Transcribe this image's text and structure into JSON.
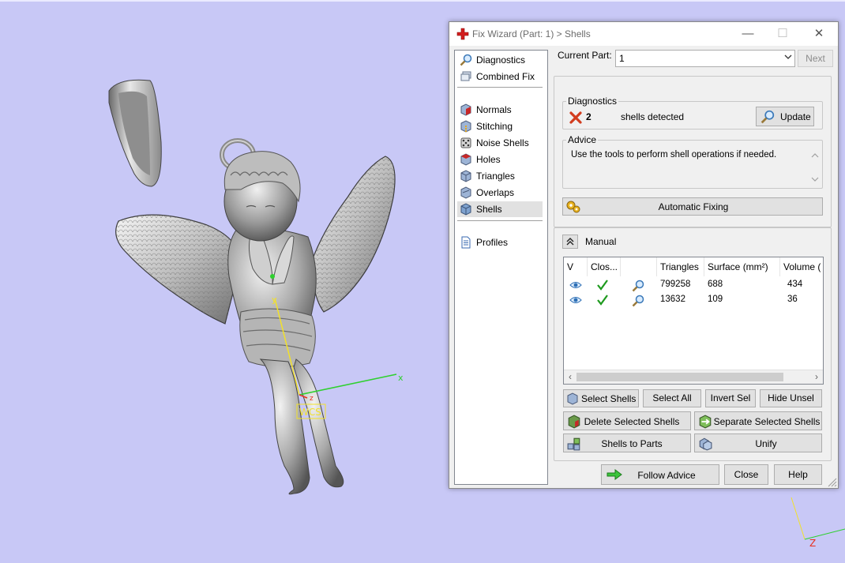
{
  "dialog": {
    "title": "Fix Wizard (Part: 1) > Shells",
    "window_controls": {
      "minimize": "—",
      "maximize": "☐",
      "close": "✕"
    }
  },
  "nav": {
    "top_items": [
      {
        "label": "Diagnostics",
        "icon": "magnifier-icon"
      },
      {
        "label": "Combined Fix",
        "icon": "stack-icon"
      }
    ],
    "fix_items": [
      {
        "label": "Normals",
        "icon": "normals-cube-icon"
      },
      {
        "label": "Stitching",
        "icon": "stitching-cube-icon"
      },
      {
        "label": "Noise Shells",
        "icon": "noise-dice-icon"
      },
      {
        "label": "Holes",
        "icon": "holes-cube-icon"
      },
      {
        "label": "Triangles",
        "icon": "triangles-cube-icon"
      },
      {
        "label": "Overlaps",
        "icon": "overlaps-cube-icon"
      },
      {
        "label": "Shells",
        "icon": "shells-cube-icon",
        "selected": true
      }
    ],
    "bottom_items": [
      {
        "label": "Profiles",
        "icon": "document-icon"
      }
    ]
  },
  "current_part": {
    "label": "Current Part:",
    "value": "1",
    "next_label": "Next"
  },
  "diagnostics": {
    "title": "Diagnostics",
    "count": "2",
    "text": "shells detected",
    "update_label": "Update",
    "status_color": "#d23c1e"
  },
  "advice": {
    "title": "Advice",
    "text": "Use the tools to perform shell operations if needed."
  },
  "auto_fix_label": "Automatic Fixing",
  "manual": {
    "title": "Manual",
    "columns": [
      "V",
      "Clos...",
      "",
      "Triangles",
      "Surface (mm²)",
      "Volume ("
    ],
    "rows": [
      {
        "triangles": "799258",
        "surface": "688",
        "volume": "434"
      },
      {
        "triangles": "13632",
        "surface": "109",
        "volume": "36"
      }
    ],
    "buttons": {
      "select_shells": "Select Shells",
      "select_all": "Select All",
      "invert_sel": "Invert Sel",
      "hide_unsel": "Hide Unsel",
      "delete_selected": "Delete Selected Shells",
      "separate_selected": "Separate Selected Shells",
      "shells_to_parts": "Shells to Parts",
      "unify": "Unify"
    }
  },
  "footer": {
    "follow_advice": "Follow Advice",
    "close": "Close",
    "help": "Help"
  },
  "viewport": {
    "background": "#c8c8f6",
    "axis_x_label": "x",
    "axis_y_label": "y",
    "axis_z_label": "z",
    "wcs_label": "WCS",
    "corner_axis_label": "Z"
  },
  "colors": {
    "axis_x": "#2fd02f",
    "axis_y": "#f2e12a",
    "axis_z": "#e83020",
    "selection": "#e1e1e1",
    "check": "#1e9a1e"
  }
}
